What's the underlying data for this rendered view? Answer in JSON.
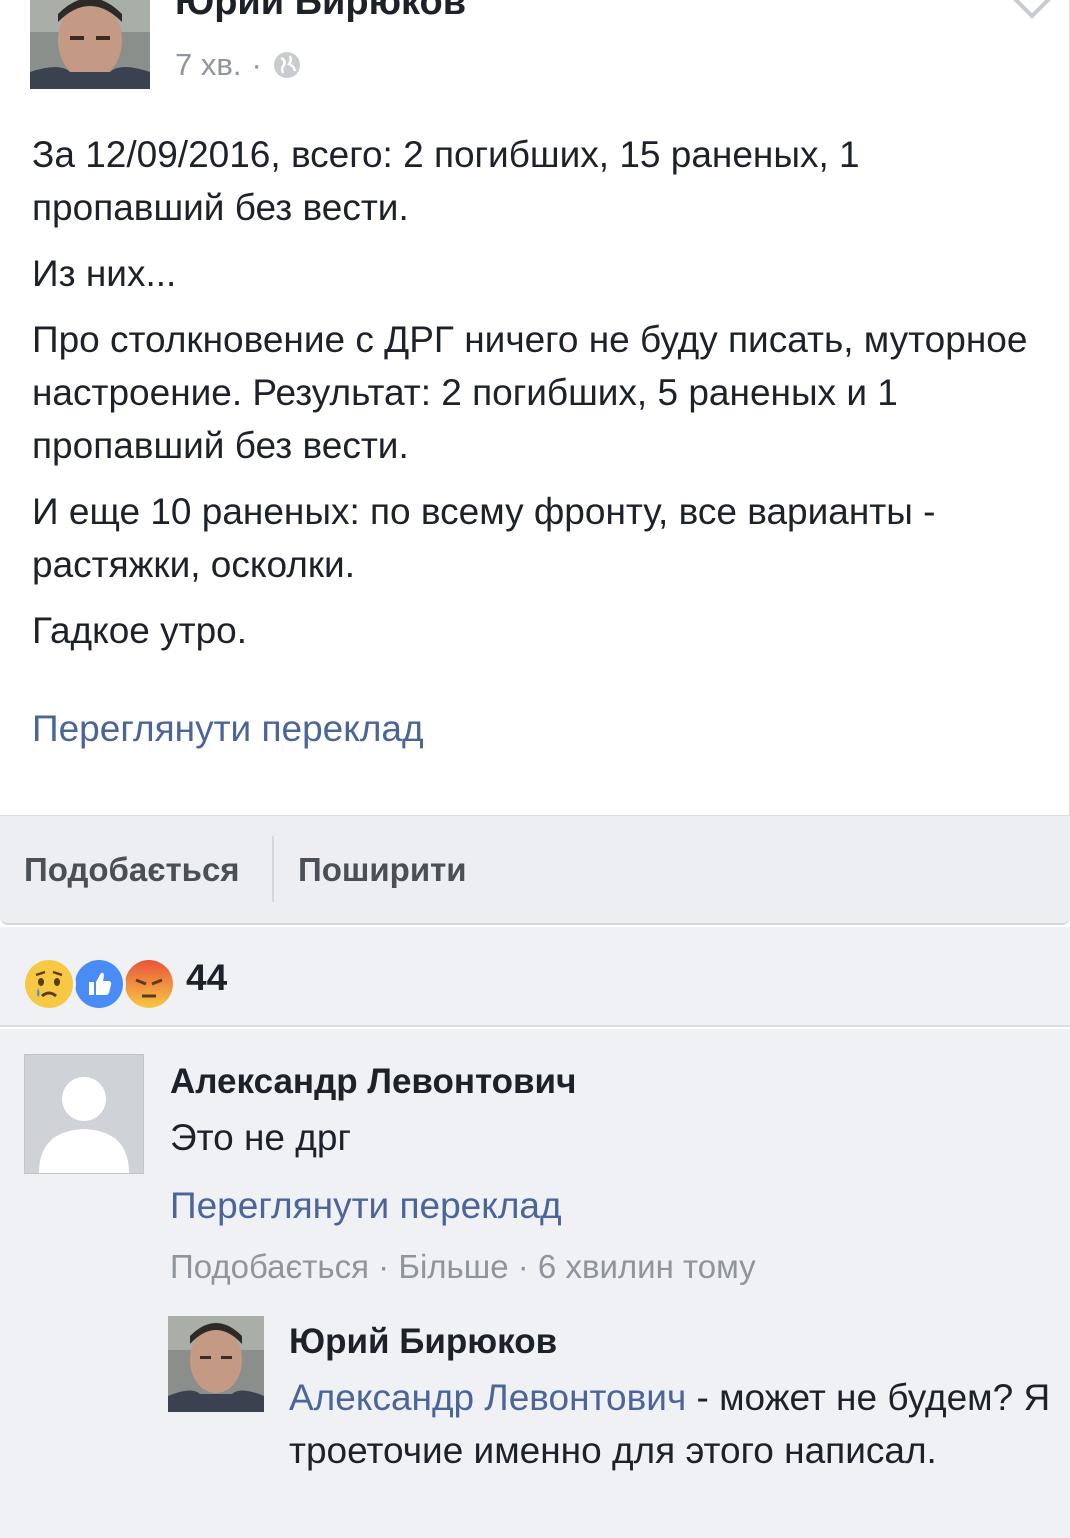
{
  "post": {
    "author": "Юрий Бирюков",
    "time": "7 хв.",
    "separator": "·",
    "paragraphs": [
      "За 12/09/2016, всего: 2 погибших, 15 раненых, 1 пропавший без вести.",
      "Из них...",
      "Про столкновение с ДРГ ничего не буду писать, муторное настроение. Результат: 2 погибших, 5 раненых и 1 пропавший без вести.",
      "И еще 10 раненых: по всему фронту, все варианты - растяжки, осколки.",
      "Гадкое утро."
    ],
    "see_translation": "Переглянути переклад"
  },
  "actions": {
    "like": "Подобається",
    "share": "Поширити"
  },
  "reactions": {
    "icons": [
      "sad-icon",
      "like-icon",
      "angry-icon"
    ],
    "count": "44",
    "colors": {
      "like": "#4a8cf5",
      "emoji": "#f7c844",
      "angry": "#e9553a"
    }
  },
  "comment": {
    "author": "Александр Левонтович",
    "text": "Это не дрг",
    "see_translation": "Переглянути переклад",
    "like": "Подобається",
    "more": "Більше",
    "time": "6 хвилин тому",
    "separator": "·"
  },
  "reply": {
    "author": "Юрий Бирюков",
    "mention": "Александр Левонтович",
    "text": " - может не будем? Я троеточие именно для этого написал."
  },
  "colors": {
    "link": "#4b6598",
    "meta": "#90949c",
    "text": "#1d2129"
  }
}
